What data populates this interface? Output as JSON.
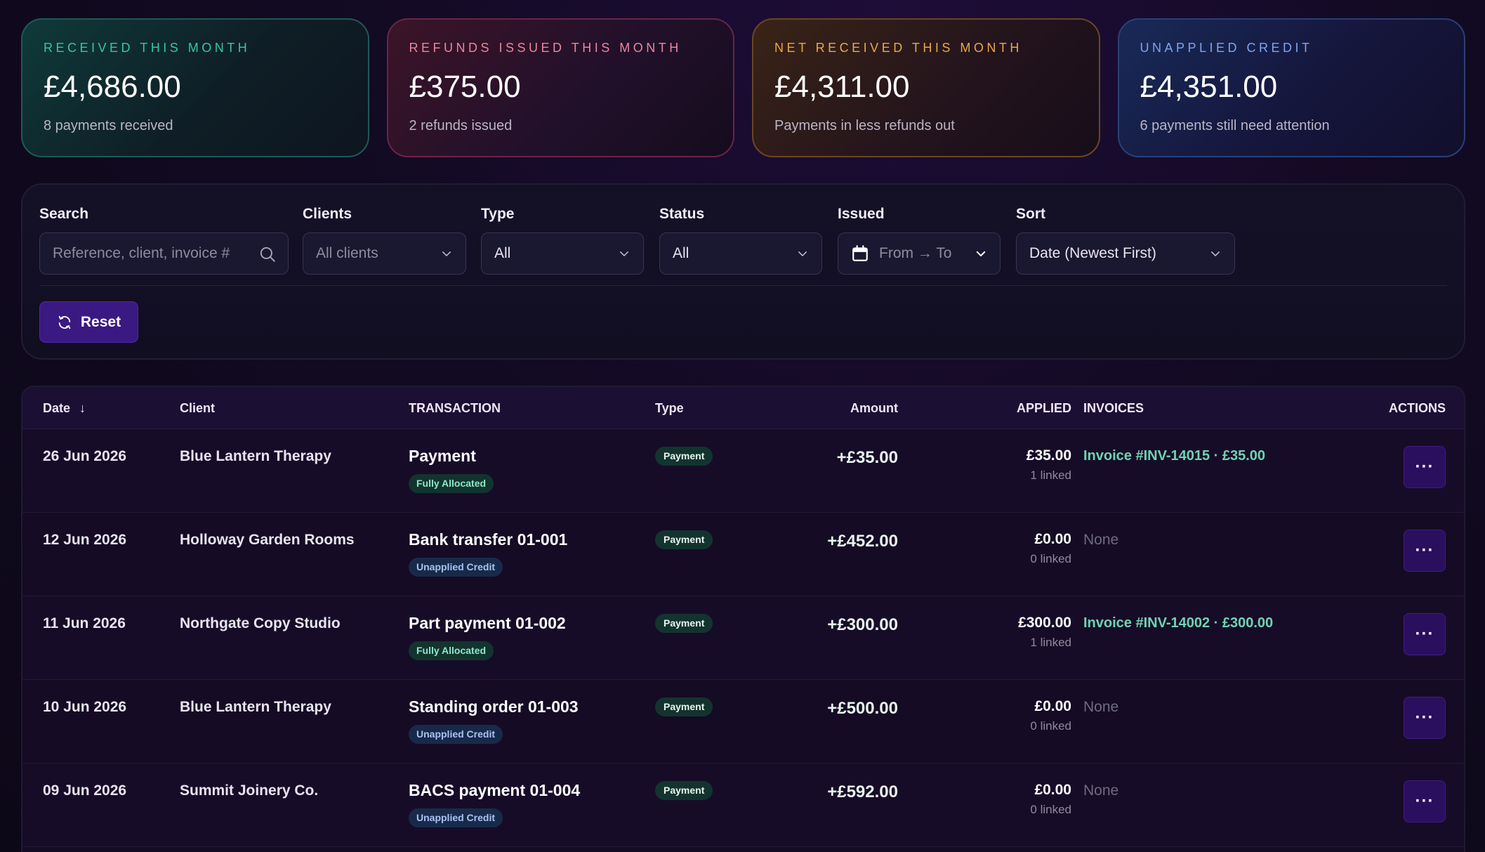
{
  "summary_cards": [
    {
      "label": "RECEIVED THIS MONTH",
      "value": "£4,686.00",
      "sub": "8 payments received",
      "color": "#34c7a4"
    },
    {
      "label": "REFUNDS ISSUED THIS MONTH",
      "value": "£375.00",
      "sub": "2 refunds issued",
      "color": "#e8879f"
    },
    {
      "label": "NET RECEIVED THIS MONTH",
      "value": "£4,311.00",
      "sub": "Payments in less refunds out",
      "color": "#e8a84a"
    },
    {
      "label": "UNAPPLIED CREDIT",
      "value": "£4,351.00",
      "sub": "6 payments still need attention",
      "color": "#7fa4ee"
    }
  ],
  "filters": {
    "search": {
      "label": "Search",
      "placeholder": "Reference, client, invoice #"
    },
    "clients": {
      "label": "Clients",
      "value": "All clients"
    },
    "type": {
      "label": "Type",
      "value": "All"
    },
    "status": {
      "label": "Status",
      "value": "All"
    },
    "issued": {
      "label": "Issued",
      "value": "From → To"
    },
    "sort": {
      "label": "Sort",
      "value": "Date (Newest First)"
    },
    "reset_label": "Reset"
  },
  "table": {
    "headers": {
      "date": "Date",
      "client": "Client",
      "transaction": "TRANSACTION",
      "type": "Type",
      "amount": "Amount",
      "applied": "APPLIED",
      "invoices": "INVOICES",
      "actions": "ACTIONS"
    },
    "sort_indicator": "↓",
    "rows": [
      {
        "date": "26 Jun 2026",
        "client": "Blue Lantern Therapy",
        "transaction": "Payment",
        "status": "Fully Allocated",
        "type": "Payment",
        "amount": "+£35.00",
        "applied": "£35.00",
        "linked": "1 linked",
        "invoice": "Invoice #INV-14015 · £35.00",
        "actions": "···"
      },
      {
        "date": "12 Jun 2026",
        "client": "Holloway Garden Rooms",
        "transaction": "Bank transfer 01-001",
        "status": "Unapplied Credit",
        "type": "Payment",
        "amount": "+£452.00",
        "applied": "£0.00",
        "linked": "0 linked",
        "invoice": "None",
        "actions": "···"
      },
      {
        "date": "11 Jun 2026",
        "client": "Northgate Copy Studio",
        "transaction": "Part payment 01-002",
        "status": "Fully Allocated",
        "type": "Payment",
        "amount": "+£300.00",
        "applied": "£300.00",
        "linked": "1 linked",
        "invoice": "Invoice #INV-14002 · £300.00",
        "actions": "···"
      },
      {
        "date": "10 Jun 2026",
        "client": "Blue Lantern Therapy",
        "transaction": "Standing order 01-003",
        "status": "Unapplied Credit",
        "type": "Payment",
        "amount": "+£500.00",
        "applied": "£0.00",
        "linked": "0 linked",
        "invoice": "None",
        "actions": "···"
      },
      {
        "date": "09 Jun 2026",
        "client": "Summit Joinery Co.",
        "transaction": "BACS payment 01-004",
        "status": "Unapplied Credit",
        "type": "Payment",
        "amount": "+£592.00",
        "applied": "£0.00",
        "linked": "0 linked",
        "invoice": "None",
        "actions": "···"
      }
    ]
  }
}
